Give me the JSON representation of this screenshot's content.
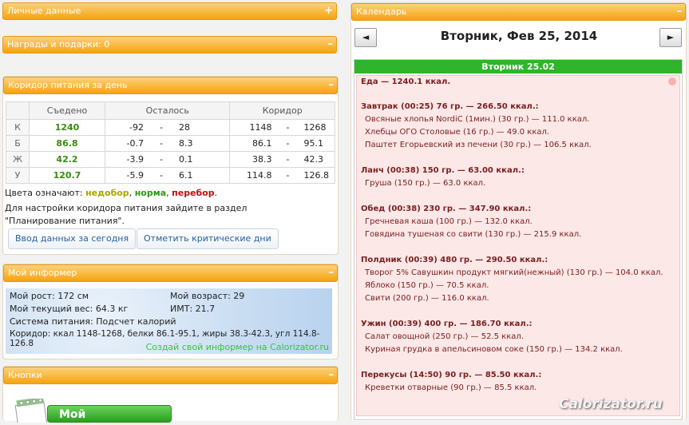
{
  "left": {
    "personal": {
      "title": "Личные данные",
      "toggle": "+"
    },
    "awards": {
      "title": "Награды и подарки: 0",
      "toggle": "–"
    },
    "corridor": {
      "title": "Коридор питания за день",
      "toggle": "–",
      "headers": [
        "Съедено",
        "Осталось",
        "Коридор"
      ],
      "rows": [
        {
          "label": "К",
          "eaten": "1240",
          "left_a": "-92",
          "left_b": "28",
          "c_min": "1148",
          "c_max": "1268"
        },
        {
          "label": "Б",
          "eaten": "86.8",
          "left_a": "-0.7",
          "left_b": "8.3",
          "c_min": "86.1",
          "c_max": "95.1"
        },
        {
          "label": "Ж",
          "eaten": "42.2",
          "left_a": "-3.9",
          "left_b": "0.1",
          "c_min": "38.3",
          "c_max": "42.3"
        },
        {
          "label": "У",
          "eaten": "120.7",
          "left_a": "-5.9",
          "left_b": "6.1",
          "c_min": "114.8",
          "c_max": "126.8"
        }
      ],
      "dash": "-",
      "legend_prefix": "Цвета означают:",
      "legend_under": "недобор",
      "legend_norm": "норма",
      "legend_over": "перебор",
      "legend_sep": ",",
      "legend_end": ".",
      "note": "Для настройки коридора питания зайдите в раздел \"Планирование питания\".",
      "btn_today": "Ввод данных за сегодня",
      "btn_critical": "Отметить критические дни"
    },
    "informer": {
      "title": "Мой информер",
      "toggle": "–",
      "height": "Мой рост: 172 см",
      "age": "Мой возраст: 29",
      "weight": "Мой текущий вес: 64.3 кг",
      "bmi": "ИМТ: 21.7",
      "system": "Система питания: Подсчет калорий",
      "corridor": "Коридор: ккал 1148-1268, белки 86.1-95.1, жиры 38.3-42.3, угл 114.8-126.8",
      "link": "Создай свой информер на Calorizator.ru"
    },
    "buttons": {
      "title": "Кнопки",
      "toggle": "–",
      "partial_label": "Мой"
    }
  },
  "calendar": {
    "title": "Календарь",
    "toggle": "–",
    "prev": "◄",
    "next": "►",
    "date": "Вторник, Фев 25, 2014",
    "day_label": "Вторник 25.02",
    "total": "Еда — 1240.1 ккал.",
    "meals": [
      {
        "head": "Завтрак (00:25) 76 гр. — 266.50 ккал.:",
        "items": [
          "Овсяные хлопья NordiC (1мин.) (30 гр.) — 111.0 ккал.",
          "Хлебцы ОГО Столовые (16 гр.) — 49.0 ккал.",
          "Паштет Егорьевский из печени (30 гр.) — 106.5 ккал."
        ]
      },
      {
        "head": "Ланч (00:38) 150 гр. — 63.00 ккал.:",
        "items": [
          "Груша (150 гр.) — 63.0 ккал."
        ]
      },
      {
        "head": "Обед (00:38) 230 гр. — 347.90 ккал.:",
        "items": [
          "Гречневая каша (100 гр.) — 132.0 ккал.",
          "Говядина тушеная со свити (130 гр.) — 215.9 ккал."
        ]
      },
      {
        "head": "Полдник (00:39) 480 гр. — 290.50 ккал.:",
        "items": [
          "Творог 5% Савушкин продукт мягкий(нежный) (130 гр.) — 104.0 ккал.",
          "Яблоко (150 гр.) — 70.5 ккал.",
          "Свити (200 гр.) — 116.0 ккал."
        ]
      },
      {
        "head": "Ужин (00:39) 400 гр. — 186.70 ккал.:",
        "items": [
          "Салат овощной (250 гр.) — 52.5 ккал.",
          "Куриная грудка в апельсиновом соке (150 гр.) — 134.2 ккал."
        ]
      },
      {
        "head": "Перекусы (14:50) 90 гр. — 85.50 ккал.:",
        "items": [
          "Креветки отварные (90 гр.) — 85.5 ккал."
        ]
      }
    ]
  },
  "watermark": "Calorizator.ru"
}
